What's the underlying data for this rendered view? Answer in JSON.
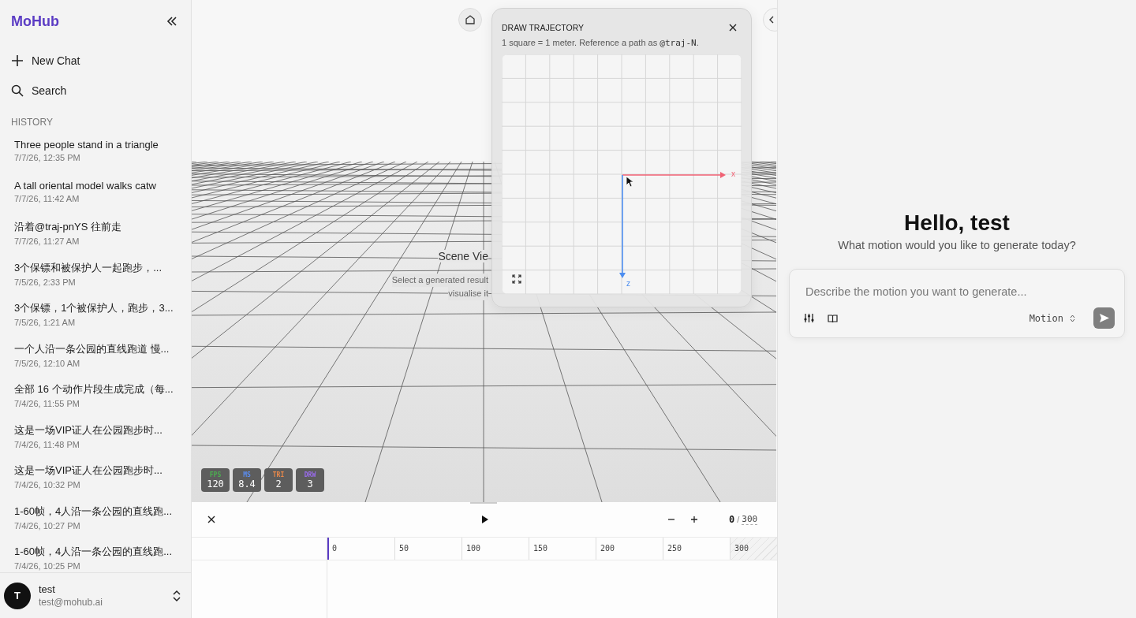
{
  "sidebar": {
    "logo": "MoHub",
    "actions": [
      {
        "kind": "new",
        "label": "New Chat"
      },
      {
        "kind": "search",
        "label": "Search"
      }
    ],
    "history_heading": "HISTORY",
    "history": [
      {
        "title": "Three people stand in a triangle",
        "time": "7/7/26, 12:35 PM"
      },
      {
        "title": "A tall oriental model walks catw",
        "time": "7/7/26, 11:42 AM"
      },
      {
        "title": "沿着@traj-pnYS 往前走",
        "time": "7/7/26, 11:27 AM"
      },
      {
        "title": "3个保镖和被保护人一起跑步，...",
        "time": "7/5/26, 2:33 PM"
      },
      {
        "title": "3个保镖，1个被保护人，跑步，3...",
        "time": "7/5/26, 1:21 AM"
      },
      {
        "title": "一个人沿一条公园的直线跑道 慢...",
        "time": "7/5/26, 12:10 AM"
      },
      {
        "title": "全部 16 个动作片段生成完成（每...",
        "time": "7/4/26, 11:55 PM"
      },
      {
        "title": "这是一场VIP证人在公园跑步时...",
        "time": "7/4/26, 11:48 PM"
      },
      {
        "title": "这是一场VIP证人在公园跑步时...",
        "time": "7/4/26, 10:32 PM"
      },
      {
        "title": "1-60帧，4人沿一条公园的直线跑...",
        "time": "7/4/26, 10:27 PM"
      },
      {
        "title": "1-60帧，4人沿一条公园的直线跑...",
        "time": "7/4/26, 10:25 PM"
      }
    ],
    "user": {
      "initial": "T",
      "name": "test",
      "email": "test@mohub.ai"
    }
  },
  "viewport": {
    "scene_title": "Scene Vie",
    "scene_hint": [
      "Select a generated result",
      "visualise it"
    ],
    "stats": [
      {
        "label": "FPS",
        "value": "120",
        "color": "#4caf50"
      },
      {
        "label": "MS",
        "value": "8.4",
        "color": "#5b8def"
      },
      {
        "label": "TRI",
        "value": "2",
        "color": "#e8884a"
      },
      {
        "label": "DRW",
        "value": "3",
        "color": "#9b6cf0"
      }
    ]
  },
  "trajectory_panel": {
    "title": "DRAW TRAJECTORY",
    "note": "1 square = 1 meter. Reference a path as ",
    "note_code": "@traj-N",
    "note_end": ".",
    "x_label": "x",
    "z_label": "z"
  },
  "timeline": {
    "frame": "0",
    "separator": "/",
    "total": "300",
    "ticks": [
      "0",
      "50",
      "100",
      "150",
      "200",
      "250",
      "300"
    ]
  },
  "chat": {
    "greeting": "Hello, test",
    "subtitle": "What motion would you like to generate today?",
    "placeholder": "Describe the motion you want to generate...",
    "mode": "Motion"
  }
}
